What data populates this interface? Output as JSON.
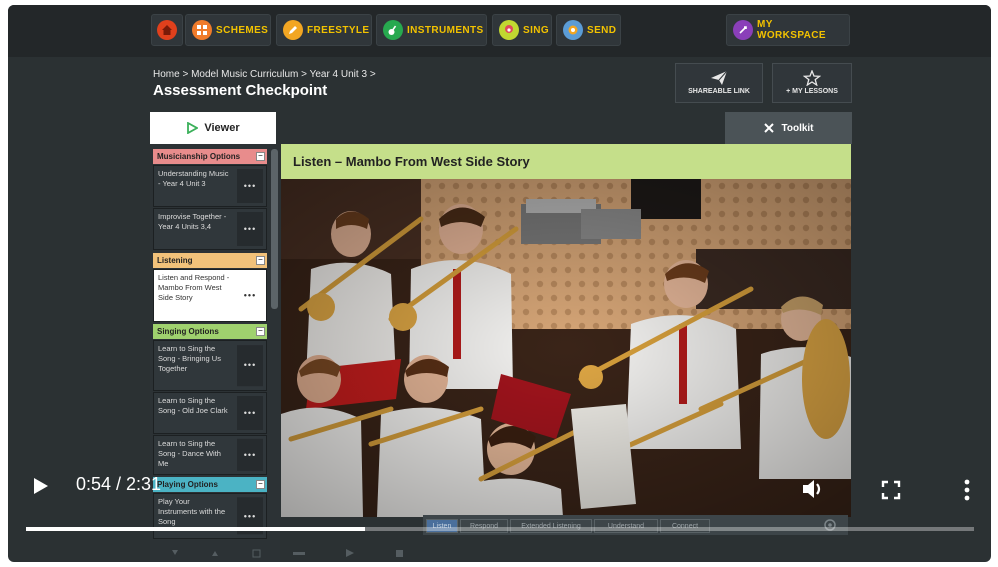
{
  "topnav": {
    "items": [
      {
        "label": "",
        "icon": "home-icon",
        "color": "#e0401c"
      },
      {
        "label": "SCHEMES",
        "icon": "grid-icon",
        "color": "#f07b2a"
      },
      {
        "label": "FREESTYLE",
        "icon": "pencil-icon",
        "color": "#f2a623"
      },
      {
        "label": "INSTRUMENTS",
        "icon": "guitar-icon",
        "color": "#27a94f"
      },
      {
        "label": "SING",
        "icon": "sing-icon",
        "color": "#c1d831"
      },
      {
        "label": "SEND",
        "icon": "send-icon",
        "color": "#5b9cd6"
      }
    ],
    "workspace_label": "MY WORKSPACE",
    "workspace_color": "#8a3fb9"
  },
  "breadcrumb": {
    "home": "Home",
    "level1": "Model Music Curriculum",
    "level2": "Year 4 Unit 3",
    "sep": ">"
  },
  "page_title": "Assessment Checkpoint",
  "actions": {
    "share_label": "SHAREABLE LINK",
    "lessons_label": "+ MY LESSONS"
  },
  "tabs": {
    "viewer": "Viewer",
    "toolkit": "Toolkit"
  },
  "sidebar": {
    "sections": [
      {
        "label": "Musicianship Options",
        "color": "#e88c8c",
        "min": "–"
      },
      {
        "label": "Listening",
        "color": "#f2c27a",
        "min": "–"
      },
      {
        "label": "Singing Options",
        "color": "#9fd16e",
        "min": "–"
      },
      {
        "label": "Playing Options",
        "color": "#4bb3c4",
        "min": "–"
      }
    ],
    "items": [
      {
        "text": "Understanding Music - Year 4 Unit 3",
        "menu": "•••"
      },
      {
        "text": "Improvise Together - Year 4 Units 3,4",
        "menu": "•••"
      },
      {
        "text": "Listen and Respond - Mambo From West Side Story",
        "menu": "•••"
      },
      {
        "text": "Learn to Sing the Song - Bringing Us Together",
        "menu": "•••"
      },
      {
        "text": "Learn to Sing the Song - Old Joe Clark",
        "menu": "•••"
      },
      {
        "text": "Learn to Sing the Song - Dance With Me",
        "menu": "•••"
      },
      {
        "text": "Play Your Instruments with the Song",
        "menu": "•••"
      }
    ]
  },
  "lesson_title": "Listen – Mambo From West Side Story",
  "under_tabs": [
    "Listen",
    "Respond",
    "Extended Listening",
    "Understand",
    "Connect"
  ],
  "player": {
    "time": "0:54 / 2:31",
    "progress": 0.358
  }
}
